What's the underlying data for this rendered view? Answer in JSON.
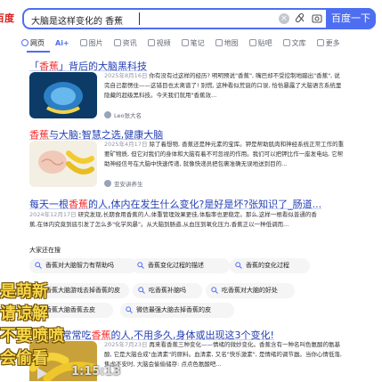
{
  "logo": {
    "text": "百度"
  },
  "search": {
    "query": "大脑是这样变化的 香蕉",
    "button_label": "百度一下"
  },
  "tabs": [
    {
      "label": "网页",
      "icon": "web-icon",
      "active": true
    },
    {
      "label": "Ai+",
      "icon": "ai-icon",
      "active": false
    },
    {
      "label": "图片",
      "icon": "image-icon",
      "active": false
    },
    {
      "label": "资讯",
      "icon": "news-icon",
      "active": false
    },
    {
      "label": "视频",
      "icon": "video-icon",
      "active": false
    },
    {
      "label": "笔记",
      "icon": "note-icon",
      "active": false
    },
    {
      "label": "地图",
      "icon": "map-icon",
      "active": false
    },
    {
      "label": "贴吧",
      "icon": "tieba-icon",
      "active": false
    },
    {
      "label": "文库",
      "icon": "wenku-icon",
      "active": false
    },
    {
      "label": "更多",
      "icon": "more-icon",
      "active": false
    }
  ],
  "results": [
    {
      "title_pre": "「",
      "title_em": "香蕉",
      "title_post": "」背后的大脑黑科技",
      "date": "2025年8月16日",
      "snippet": "你有没有过这样的经历? 明明预说\"香蕉\", 嘴巴却不受控制地蹦出\"香蕉\", 说完自己都愣住——这错目也太离谱了! 别慌, 这种看似荒诞的口误, 恰恰暴露了大脑语言系统里隐藏的超级黑科技。今天我们就用\"香蕉效...",
      "source": "Leo张大名"
    },
    {
      "title_pre": "",
      "title_em": "香蕉",
      "title_post": "与大脑:智慧之选,健康大脑",
      "date": "2025年4月17日",
      "snippet": "除了着想物, 香蕉还是种元素的宝库。钾是帮助肌肉和神经系统正常工作的重要矿物质, 但它对我们的身体和大脑有着不可忽视的作用。我们可以把钾比作一座发电站, 它帮助神经信号在大脑中快速传递, 就像快递员把包裹准确无误地送到目的...",
      "source": "亚安讲养生"
    },
    {
      "title_pre": "每天一根",
      "title_em": "香蕉",
      "title_post": "的人,体内在发生什么变化?是好是坏?张知识了_肠道...",
      "date": "2024年12月17日",
      "snippet": "研究发现,长期食用香蕉的人,体重管理效果更佳,体脂率也更稳定。那么,这样一根看似普通的香蕉,在体内究竟到底引发了怎么多\"化学风暴\"。从大脑到肠道,从血压到氧化压力,香蕉正以一种低调而...",
      "source": ""
    },
    {
      "title_pre": "吃香蕉,常常吃",
      "title_em": "香蕉",
      "title_post": "的人,不用多久,身体或出现这3个变化!",
      "date": "2025年7月23日",
      "snippet": "再来看香蕉三种变化——情绪的微妙变化。香蕉含有一种名叫色氨酸的氨基酸, 它是大脑合成\"血清素\"的原料。血清素, 又名\"快乐激素\", 是情绪的调节器。当你心情低落, 焦虑不安时, 大脑会偷偷储存: 点点色氨酸吧...",
      "source": ""
    }
  ],
  "related": {
    "header": "大家还在搜",
    "items": [
      "香蕉对大脑智力有帮助吗",
      "香蕉变化过程的描述",
      "香蕉的变化过程",
      "香蕉大脑游戏去掉香蕉的皮",
      "吃香蕉补脑吗",
      "吃香蕉对大脑的好处",
      "香蕉大脑香蕉去皮",
      "微信最强大脑去掉香蕉的皮"
    ]
  },
  "overlay_captions": [
    "是萌新",
    "请谅解",
    "不要喷喷",
    "会偷看"
  ],
  "player": {
    "time": "1:15:13"
  },
  "colors": {
    "accent": "#4e6ef2",
    "highlight": "#f73131",
    "link": "#2440b3",
    "caption": "#f7d84a"
  }
}
